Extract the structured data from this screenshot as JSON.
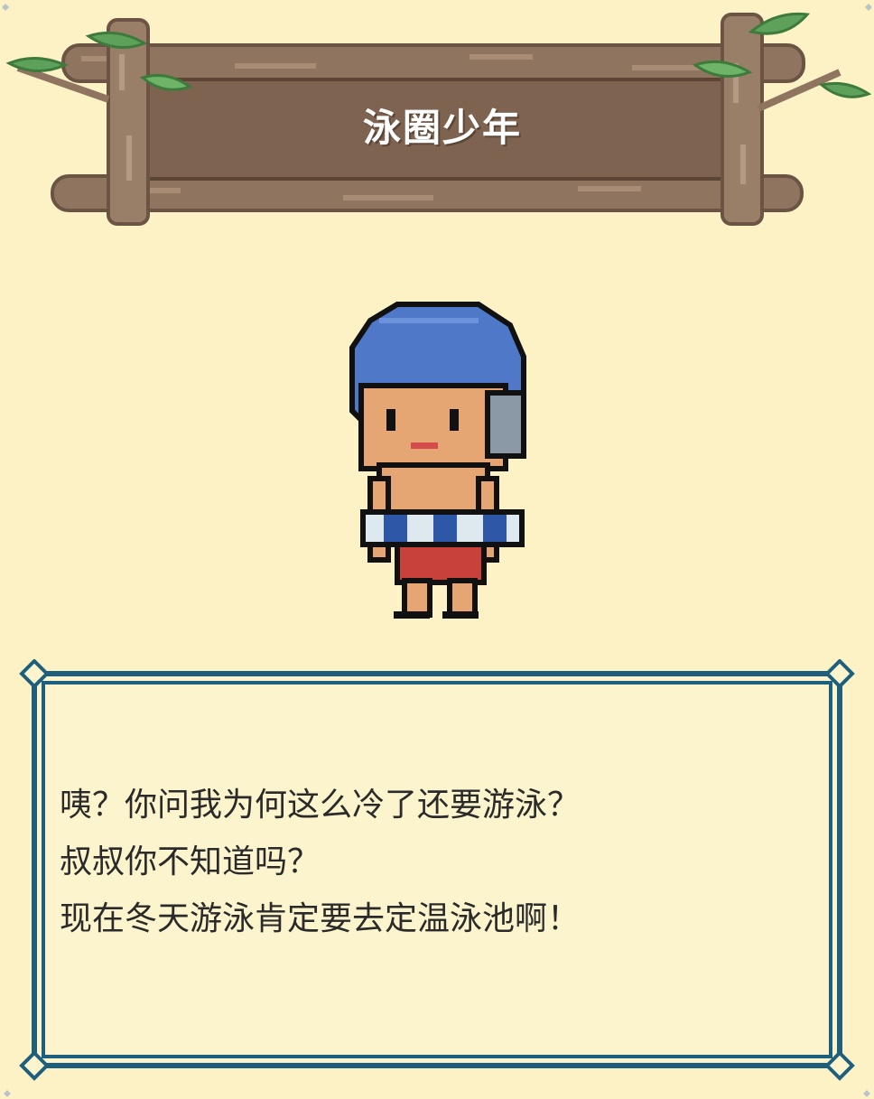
{
  "header": {
    "title": "泳圈少年"
  },
  "npc": {
    "sprite_icon": "swim-ring-boy-sprite"
  },
  "dialog": {
    "lines": [
      "咦？你问我为何这么冷了还要游泳？",
      "叔叔你不知道吗？",
      "现在冬天游泳肯定要去定温泳池啊！"
    ]
  },
  "colors": {
    "background": "#fcf2c5",
    "wood": "#8a6e58",
    "wood_dark": "#5c4535",
    "frame": "#1e5f7e",
    "leaf": "#5ea15a",
    "cap": "#4f78c9",
    "trunks": "#c9413b",
    "skin": "#e6a674"
  }
}
